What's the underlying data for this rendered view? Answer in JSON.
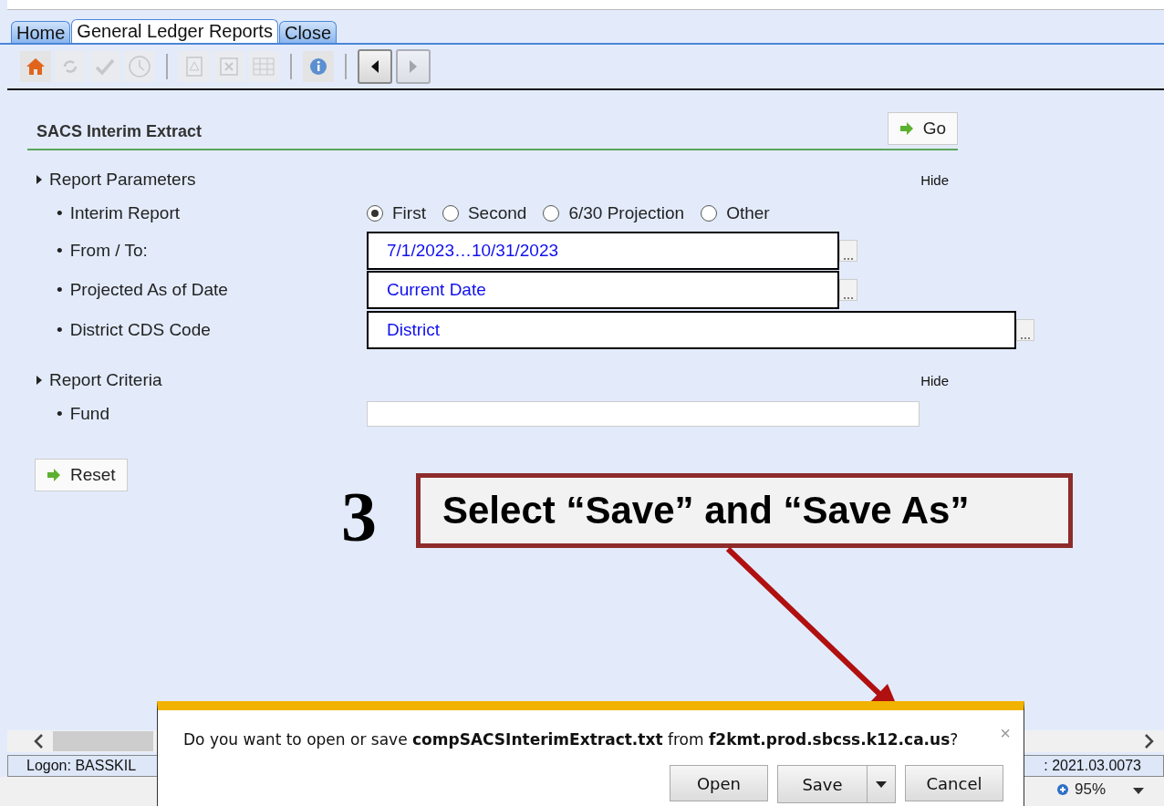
{
  "tabs": [
    {
      "label": "Home",
      "selected": false
    },
    {
      "label": "General Ledger Reports",
      "selected": true
    },
    {
      "label": "Close",
      "selected": false
    }
  ],
  "toolbar": [
    {
      "kind": "home",
      "disabled": false
    },
    {
      "kind": "refresh",
      "disabled": true
    },
    {
      "kind": "check",
      "disabled": true
    },
    {
      "kind": "clock",
      "disabled": true
    },
    {
      "kind": "separator"
    },
    {
      "kind": "pdf",
      "disabled": true
    },
    {
      "kind": "excel",
      "disabled": true
    },
    {
      "kind": "grid",
      "disabled": true
    },
    {
      "kind": "separator"
    },
    {
      "kind": "info",
      "disabled": false
    },
    {
      "kind": "separator"
    },
    {
      "kind": "back",
      "disabled": false
    },
    {
      "kind": "forward",
      "disabled": true
    }
  ],
  "form": {
    "title": "SACS Interim Extract",
    "go_button": "Go",
    "sections": [
      {
        "title": "Report Parameters",
        "hide": "Hide",
        "rows": [
          {
            "kind": "radio",
            "bullet": "•",
            "label": "Interim Report",
            "options": [
              {
                "label": "First",
                "selected": true
              },
              {
                "label": "Second",
                "selected": false
              },
              {
                "label": "6/30 Projection",
                "selected": false
              },
              {
                "label": "Other",
                "selected": false
              }
            ]
          },
          {
            "kind": "lookup",
            "bullet": "•",
            "label": "From / To:",
            "value": "7/1/2023…10/31/2023"
          },
          {
            "kind": "lookup",
            "bullet": "•",
            "label": "Projected As of Date",
            "value": "Current Date"
          },
          {
            "kind": "wide_lookup",
            "bullet": "•",
            "label": "District CDS Code",
            "value": "District"
          }
        ]
      },
      {
        "title": "Report Criteria",
        "hide": "Hide",
        "rows": [
          {
            "kind": "text",
            "bullet": "•",
            "label": "Fund"
          }
        ]
      }
    ],
    "reset_button": "Reset"
  },
  "callout": {
    "number": "3",
    "text": "Select “Save” and “Save As”"
  },
  "status_bar": {
    "logon": "Logon: BASSKIL",
    "version": ": 2021.03.0073",
    "zoom": "95%"
  },
  "dialog": {
    "close": "×",
    "message": "Do you want to open or save **compSACSInterimExtract.txt** from **f2kmt.prod.sbcss.k12.ca.us**?",
    "buttons": [
      {
        "kind": "plain",
        "label": "Open"
      },
      {
        "kind": "split",
        "label": "Save"
      },
      {
        "kind": "plain",
        "label": "Cancel"
      }
    ]
  }
}
